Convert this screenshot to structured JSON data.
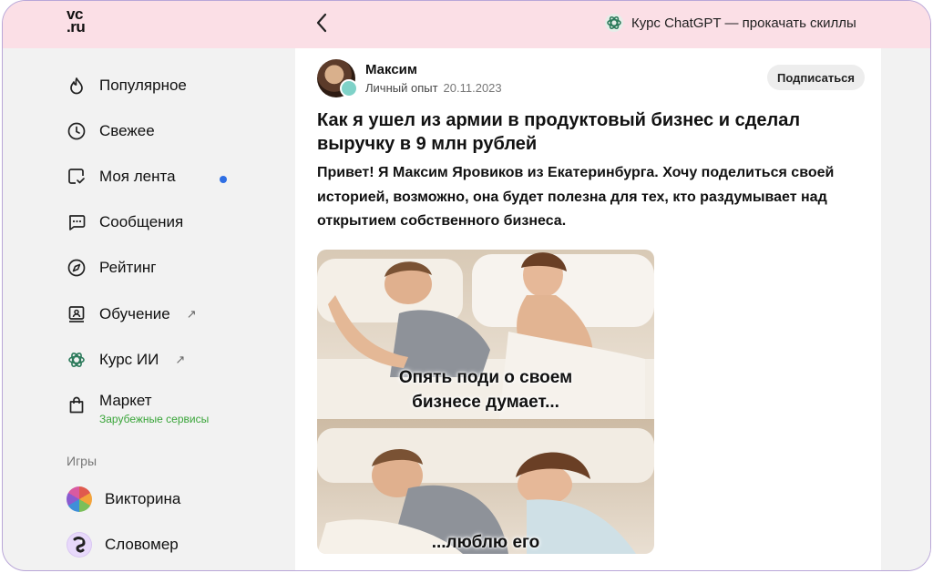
{
  "header": {
    "logo_top": "vc",
    "logo_bottom": ".ru",
    "promo_text": "Курс ChatGPT — прокачать скиллы"
  },
  "sidebar": {
    "items": [
      {
        "label": "Популярное",
        "icon": "flame-icon"
      },
      {
        "label": "Свежее",
        "icon": "clock-icon",
        "unread": true
      },
      {
        "label": "Моя лента",
        "icon": "feed-check-icon"
      },
      {
        "label": "Сообщения",
        "icon": "chat-icon"
      },
      {
        "label": "Рейтинг",
        "icon": "compass-icon"
      },
      {
        "label": "Обучение",
        "icon": "presentation-icon",
        "external": "↗"
      },
      {
        "label": "Курс ИИ",
        "icon": "openai-icon",
        "external": "↗"
      },
      {
        "label": "Маркет",
        "icon": "shopping-bag-icon",
        "sublabel": "Зарубежные сервисы"
      }
    ],
    "games_label": "Игры",
    "games": [
      {
        "label": "Викторина",
        "icon": "pie-wheel-icon"
      },
      {
        "label": "Словомер",
        "icon": "slovomer-icon"
      }
    ]
  },
  "post": {
    "author": "Максим",
    "category": "Личный опыт",
    "date": "20.11.2023",
    "subscribe_label": "Подписаться",
    "title": "Как я ушел из армии в продуктовый бизнес и сделал выручку в 9 млн рублей",
    "lead": "Привет! Я Максим Яровиков из Екатеринбурга. Хочу поделиться своей историей, возможно, она будет полезна для тех, кто раздумывает над открытием собственного бизнеса.",
    "meme": {
      "caption_top": "Опять поди о своем бизнесе думает...",
      "caption_bottom": "...люблю его"
    }
  },
  "colors": {
    "header_bg": "#fbdfe6",
    "accent_dot": "#2f6fe4",
    "market_sub": "#3aa53a",
    "frame_border": "#b9a6d8"
  }
}
